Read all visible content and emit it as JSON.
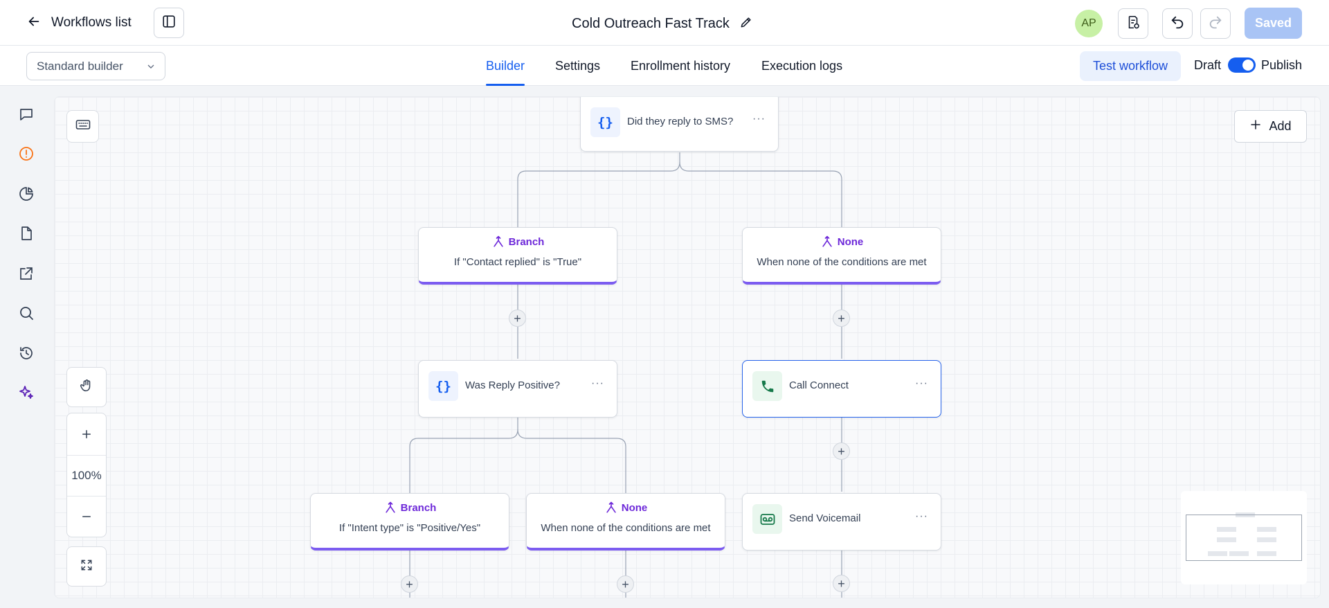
{
  "header": {
    "back_label": "Workflows list",
    "title": "Cold Outreach Fast Track",
    "avatar_initials": "AP",
    "saved_label": "Saved"
  },
  "subnav": {
    "builder_select": "Standard builder",
    "tabs": [
      {
        "label": "Builder",
        "active": true
      },
      {
        "label": "Settings",
        "active": false
      },
      {
        "label": "Enrollment history",
        "active": false
      },
      {
        "label": "Execution logs",
        "active": false
      }
    ],
    "test_workflow_label": "Test workflow",
    "draft_label": "Draft",
    "publish_label": "Publish",
    "publish_toggle_on": true
  },
  "sidebar": {
    "icons": [
      "chat-icon",
      "alert-icon",
      "pie-chart-icon",
      "file-icon",
      "external-link-icon",
      "search-icon",
      "history-icon",
      "sparkle-icon"
    ]
  },
  "canvas": {
    "add_label": "Add",
    "zoom_label": "100%",
    "nodes": {
      "reply_sms": "Did they reply to SMS?",
      "branch1_title": "Branch",
      "branch1_sub": "If \"Contact replied\" is \"True\"",
      "none1_title": "None",
      "none1_sub": "When none of the conditions are met",
      "reply_positive": "Was Reply Positive?",
      "call_connect": "Call Connect",
      "branch2_title": "Branch",
      "branch2_sub": "If \"Intent type\" is \"Positive/Yes\"",
      "none2_title": "None",
      "none2_sub": "When none of the conditions are met",
      "send_voicemail": "Send Voicemail",
      "condition_icon_glyph": "{}",
      "menu_glyph": "···",
      "plus_glyph": "+"
    }
  },
  "colors": {
    "accent": "#155eef",
    "branch": "#7c5cf0",
    "call_green": "#16794a",
    "saved_bg": "#a9c4f5",
    "alert_orange": "#f97316"
  }
}
